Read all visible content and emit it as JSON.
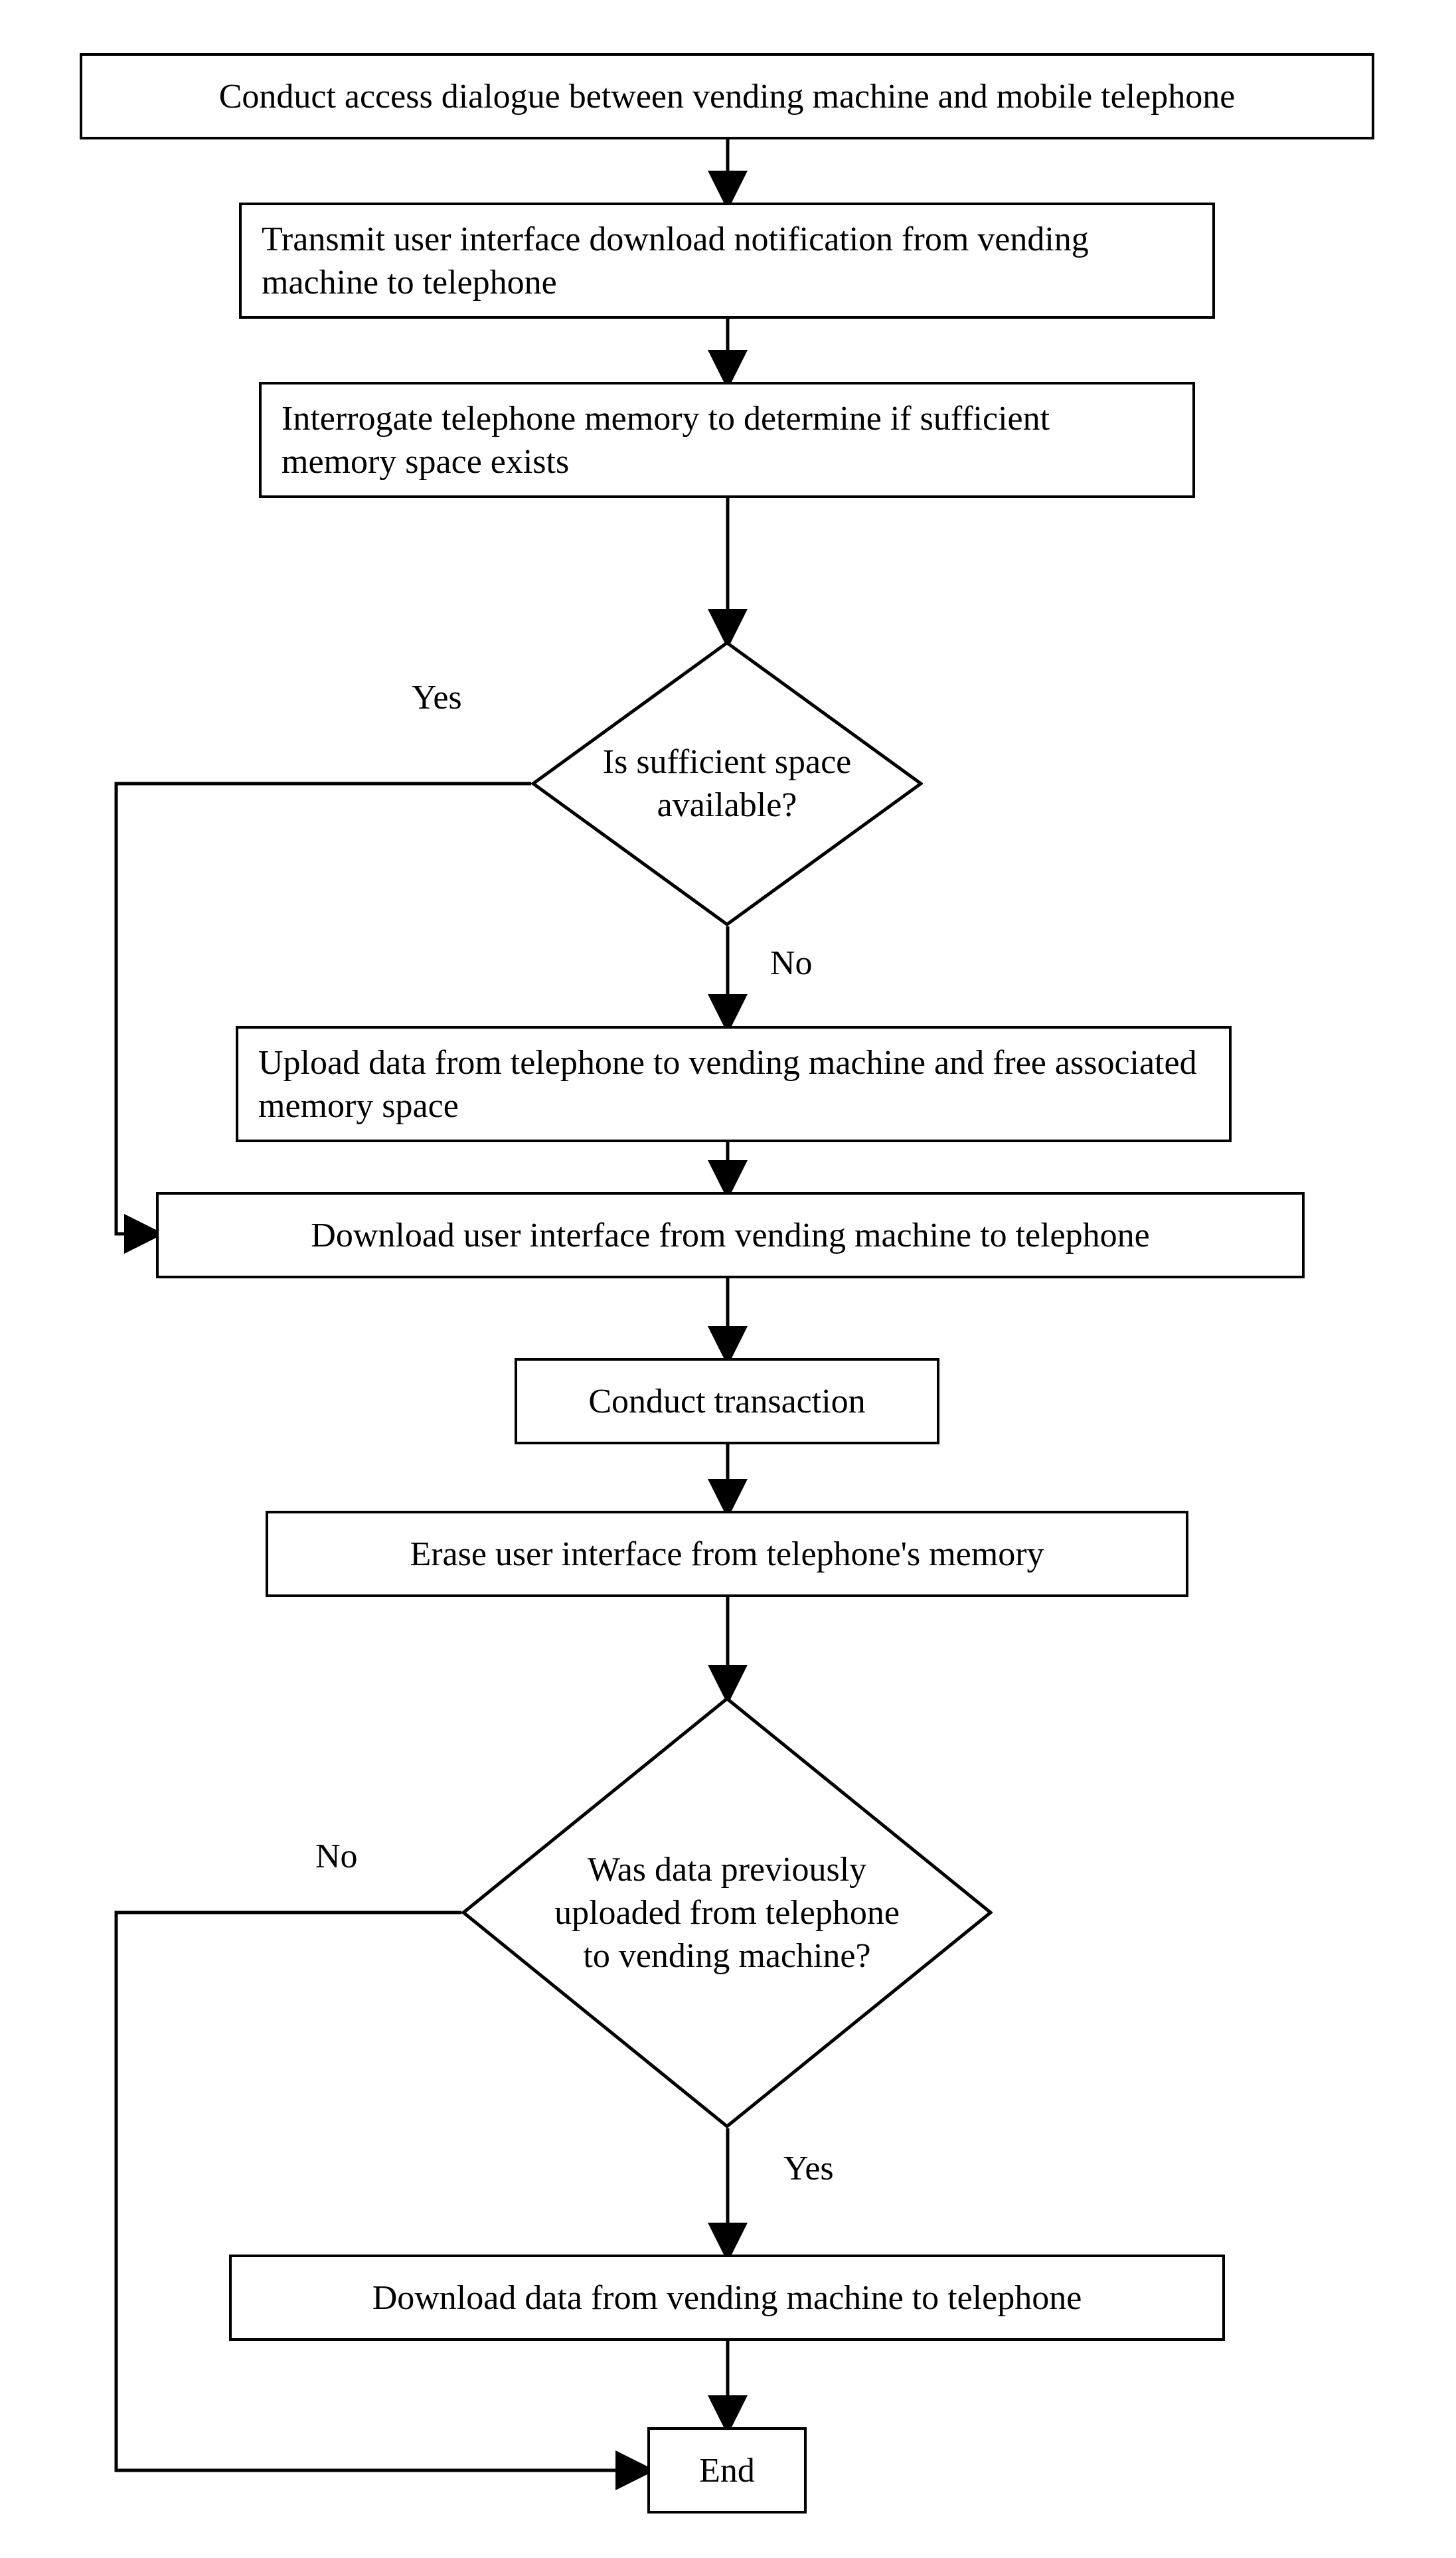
{
  "nodes": {
    "n1": "Conduct access dialogue between vending machine and mobile telephone",
    "n2": "Transmit user interface download notification from vending machine to telephone",
    "n3": "Interrogate telephone memory to determine if sufficient memory space exists",
    "d1": "Is sufficient space available?",
    "n4": "Upload data from telephone to vending machine and free associated memory space",
    "n5": "Download user interface from vending machine to telephone",
    "n6": "Conduct transaction",
    "n7": "Erase user interface from telephone's memory",
    "d2": "Was data previously uploaded from telephone to vending machine?",
    "n8": "Download data from vending machine to telephone",
    "n9": "End"
  },
  "labels": {
    "d1_yes": "Yes",
    "d1_no": "No",
    "d2_no": "No",
    "d2_yes": "Yes"
  }
}
